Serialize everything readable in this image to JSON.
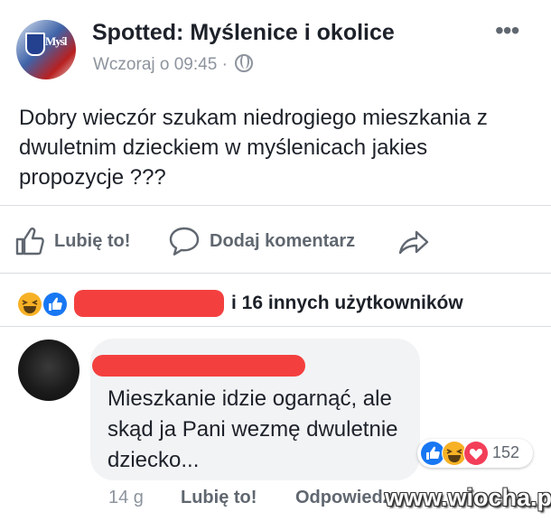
{
  "post": {
    "page_name": "Spotted: Myślenice i okolice",
    "timestamp": "Wczoraj o 09:45",
    "separator": "·",
    "more": "•••",
    "body": "Dobry wieczór szukam niedrogiego mieszkania z dwuletnim dzieckiem w myślenicach jakies propozycje ???",
    "avatar_text": "Myśl"
  },
  "actions": {
    "like": "Lubię to!",
    "comment": "Dodaj komentarz"
  },
  "reactions": {
    "others": "i 16 innych użytkowników",
    "icons": [
      "haha-icon",
      "like-icon"
    ]
  },
  "comment": {
    "text": "Mieszkanie idzie ogarnąć, ale skąd ja Pani wezmę dwuletnie dziecko...",
    "reaction_count": "152",
    "time": "14 g",
    "like": "Lubię to!",
    "reply": "Odpowiedz"
  },
  "watermark": "www.wiocha.pl",
  "colors": {
    "facebook_blue": "#1877f2",
    "haha_yellow": "#f7b125",
    "love_red": "#f33e58",
    "redaction_red": "#f3403f",
    "meta_gray": "#8d949e"
  }
}
